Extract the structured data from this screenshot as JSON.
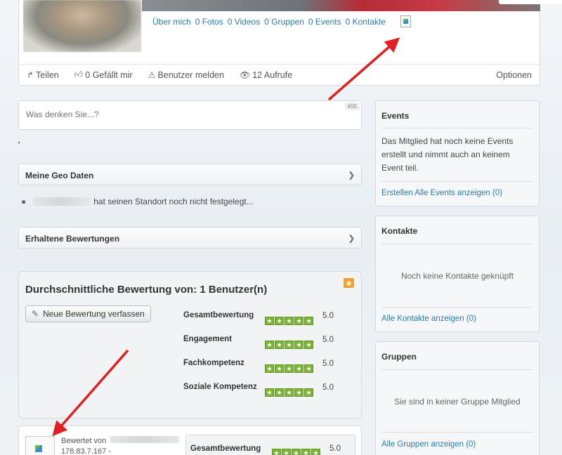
{
  "profile": {
    "links": [
      "Über mich",
      "0 Fotos",
      "0 Videos",
      "0 Gruppen",
      "0 Events",
      "0 Kontakte"
    ],
    "actions": {
      "share": "Teilen",
      "like": "0 Gefällt mir",
      "report": "Benutzer melden",
      "views": "12 Aufrufe",
      "options": "Optionen"
    }
  },
  "status": {
    "placeholder": "Was denken Sie...?",
    "counter": "400"
  },
  "geo": {
    "header": "Meine Geo Daten",
    "text": "hat seinen Standort noch nicht festgelegt..."
  },
  "ratings_header": "Erhaltene Bewertungen",
  "rating_panel": {
    "title": "Durchschnittliche Bewertung von: 1 Benutzer(n)",
    "new_button": "Neue Bewertung verfassen",
    "rows": [
      {
        "label": "Gesamtbewertung",
        "value": "5.0",
        "stars": 5
      },
      {
        "label": "Engagement",
        "value": "5.0",
        "stars": 5
      },
      {
        "label": "Fachkompetenz",
        "value": "5.0",
        "stars": 5
      },
      {
        "label": "Soziale Kompetenz",
        "value": "5.0",
        "stars": 5
      }
    ]
  },
  "review": {
    "by_label": "Bewertet von",
    "ip": "178.83.7.167  -",
    "label": "Gesamtbewertung",
    "value": "5.0"
  },
  "sidebar": {
    "events": {
      "title": "Events",
      "text": "Das Mitglied hat noch keine Events erstellt und nimmt auch an keinem Event teil.",
      "link": "Erstellen Alle Events anzeigen (0)"
    },
    "contacts": {
      "title": "Kontakte",
      "empty": "Noch keine Kontakte geknüpft",
      "link": "Alle Kontakte anzeigen (0)"
    },
    "groups": {
      "title": "Gruppen",
      "empty": "Sie sind in keiner Gruppe Mitglied",
      "link": "Alle Gruppen anzeigen (0)"
    }
  },
  "colors": {
    "link": "#2a7ab0",
    "star_green": "#7cb82f",
    "annotation_red": "#e02020",
    "rss_orange": "#f2a02a"
  }
}
